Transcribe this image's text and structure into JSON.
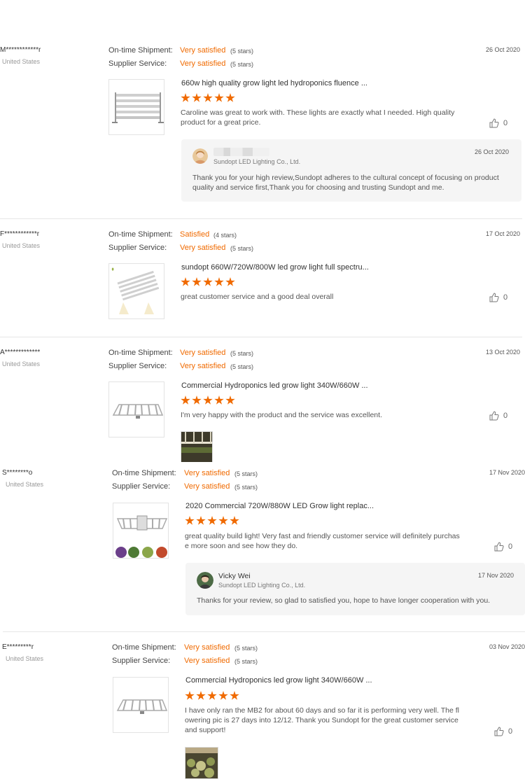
{
  "reviews": [
    {
      "user": "M************r",
      "country": "United States",
      "date": "26 Oct 2020",
      "shipment_label": "On-time Shipment:",
      "shipment_value": "Very satisfied",
      "shipment_stars": "(5 stars)",
      "service_label": "Supplier Service:",
      "service_value": "Very satisfied",
      "service_stars": "(5 stars)",
      "product_title": "660w high quality grow light led hydroponics fluence ...",
      "rating": 5,
      "comment": "Caroline was great to work with.  These lights are exactly what I needed.   High quality product for a great price.",
      "likes": "0",
      "reply": {
        "name": "",
        "company": "Sundopt LED Lighting Co., Ltd.",
        "date": "26 Oct 2020",
        "text": "Thank you for your high review,Sundopt adheres to the cultural concept of focusing on product quality and service first,Thank you for choosing and trusting Sundopt and me."
      }
    },
    {
      "user": "F************r",
      "country": "United States",
      "date": "17 Oct 2020",
      "shipment_label": "On-time Shipment:",
      "shipment_value": "Satisfied",
      "shipment_stars": "(4 stars)",
      "service_label": "Supplier Service:",
      "service_value": "Very satisfied",
      "service_stars": "(5 stars)",
      "product_title": "sundopt 660W/720W/800W led grow light full spectru...",
      "rating": 5,
      "comment": "great customer service and a good deal overall",
      "likes": "0"
    },
    {
      "user": "A*************",
      "country": "United States",
      "date": "13 Oct 2020",
      "shipment_label": "On-time Shipment:",
      "shipment_value": "Very satisfied",
      "shipment_stars": "(5 stars)",
      "service_label": "Supplier Service:",
      "service_value": "Very satisfied",
      "service_stars": "(5 stars)",
      "product_title": "Commercial Hydroponics led grow light 340W/660W ...",
      "rating": 5,
      "comment": "I'm very happy with the product and the service was excellent.",
      "likes": "0"
    },
    {
      "user": "S********o",
      "country": "United States",
      "date": "17 Nov 2020",
      "shipment_label": "On-time Shipment:",
      "shipment_value": "Very satisfied",
      "shipment_stars": "(5 stars)",
      "service_label": "Supplier Service:",
      "service_value": "Very satisfied",
      "service_stars": "(5 stars)",
      "product_title": "2020 Commercial 720W/880W LED Grow light replac...",
      "rating": 5,
      "comment": "great quality build light! Very fast and friendly customer service will definitely purchase more soon and see how they do.",
      "likes": "0",
      "reply": {
        "name": "Vicky Wei",
        "company": "Sundopt LED Lighting Co., Ltd.",
        "date": "17 Nov 2020",
        "text": "Thanks for your review, so glad to satisfied you, hope to have longer cooperation with you."
      }
    },
    {
      "user": "E*********r",
      "country": "United States",
      "date": "03 Nov 2020",
      "shipment_label": "On-time Shipment:",
      "shipment_value": "Very satisfied",
      "shipment_stars": "(5 stars)",
      "service_label": "Supplier Service:",
      "service_value": "Very satisfied",
      "service_stars": "(5 stars)",
      "product_title": "Commercial Hydroponics led grow light 340W/660W ...",
      "rating": 5,
      "comment": "I have only ran the MB2 for about 60 days and so far it is performing very well. The flowering pic is 27 days into 12/12. Thank you Sundopt for the great customer service and support!",
      "likes": "0"
    }
  ],
  "colors": {
    "accent": "#f06a00",
    "reply_bg": "#f5f5f5",
    "divider": "#e6e6e6"
  },
  "icons": {
    "like": "thumbs-up-icon",
    "star": "star-icon"
  }
}
